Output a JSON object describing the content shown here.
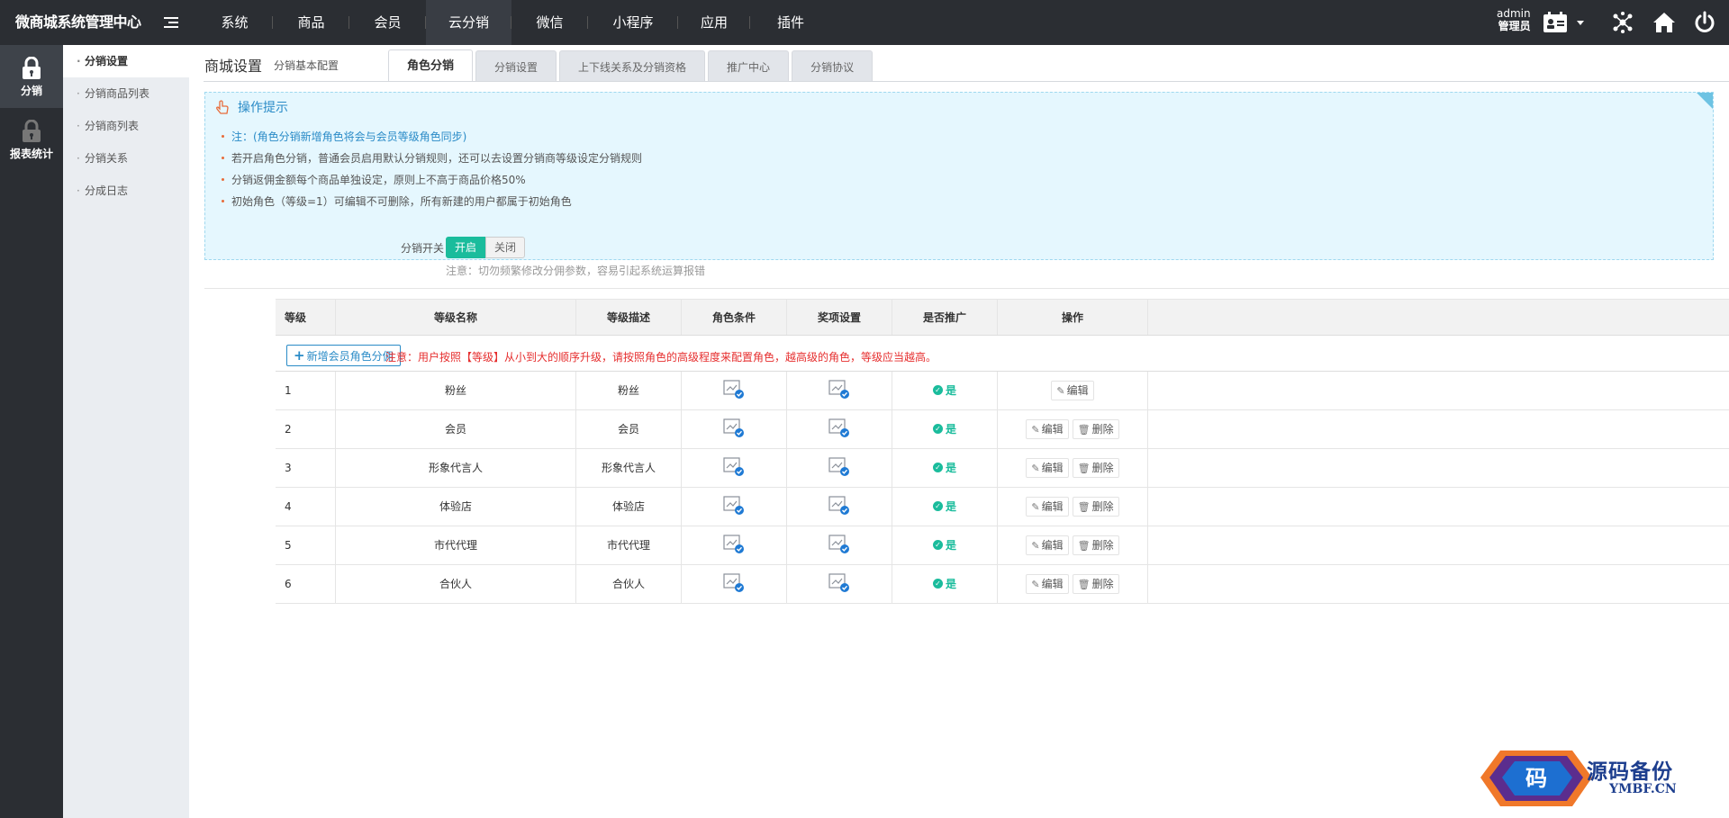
{
  "brand": "微商城系统管理中心",
  "top_nav": [
    {
      "label": "系统",
      "active": false
    },
    {
      "label": "商品",
      "active": false
    },
    {
      "label": "会员",
      "active": false
    },
    {
      "label": "云分销",
      "active": true
    },
    {
      "label": "微信",
      "active": false
    },
    {
      "label": "小程序",
      "active": false
    },
    {
      "label": "应用",
      "active": false
    },
    {
      "label": "插件",
      "active": false
    }
  ],
  "user": {
    "name": "admin",
    "role": "管理员"
  },
  "top_icons": [
    "id-card-icon",
    "caret-down-icon",
    "network-icon",
    "home-icon",
    "power-icon"
  ],
  "left_nav": [
    {
      "label": "分销",
      "icon": "lock-icon",
      "active": true
    },
    {
      "label": "报表统计",
      "icon": "lock-icon",
      "active": false
    }
  ],
  "submenu": [
    {
      "label": "分销设置",
      "active": true
    },
    {
      "label": "分销商品列表",
      "active": false
    },
    {
      "label": "分销商列表",
      "active": false
    },
    {
      "label": "分销关系",
      "active": false
    },
    {
      "label": "分成日志",
      "active": false
    }
  ],
  "page": {
    "title": "商城设置",
    "subtitle": "分销基本配置"
  },
  "tabs": [
    {
      "label": "角色分销",
      "active": true
    },
    {
      "label": "分销设置",
      "active": false
    },
    {
      "label": "上下线关系及分销资格",
      "active": false
    },
    {
      "label": "推广中心",
      "active": false
    },
    {
      "label": "分销协议",
      "active": false
    }
  ],
  "tips": {
    "title": "操作提示",
    "items": [
      {
        "text": "注：(角色分销新增角色将会与会员等级角色同步)",
        "highlight": true
      },
      {
        "text": "若开启角色分销，普通会员启用默认分销规则，还可以去设置分销商等级设定分销规则",
        "highlight": false
      },
      {
        "text": "分销返佣金额每个商品单独设定，原则上不高于商品价格50%",
        "highlight": false
      },
      {
        "text": "初始角色（等级=1）可编辑不可删除，所有新建的用户都属于初始角色",
        "highlight": false
      }
    ]
  },
  "switch": {
    "label": "分销开关",
    "on_label": "开启",
    "off_label": "关闭",
    "value": "开启",
    "note": "注意：切勿频繁修改分佣参数，容易引起系统运算报错"
  },
  "table": {
    "columns": [
      "等级",
      "等级名称",
      "等级描述",
      "角色条件",
      "奖项设置",
      "是否推广",
      "操作"
    ],
    "add_button": "新增会员角色分佣",
    "add_note": "注意：用户按照【等级】从小到大的顺序升级，请按照角色的高级程度来配置角色，越高级的角色，等级应当越高。",
    "yes_label": "是",
    "edit_label": "编辑",
    "delete_label": "删除",
    "rows": [
      {
        "level": "1",
        "name": "粉丝",
        "desc": "粉丝",
        "promote": "是",
        "deletable": false
      },
      {
        "level": "2",
        "name": "会员",
        "desc": "会员",
        "promote": "是",
        "deletable": true
      },
      {
        "level": "3",
        "name": "形象代言人",
        "desc": "形象代言人",
        "promote": "是",
        "deletable": true
      },
      {
        "level": "4",
        "name": "体验店",
        "desc": "体验店",
        "promote": "是",
        "deletable": true
      },
      {
        "level": "5",
        "name": "市代代理",
        "desc": "市代代理",
        "promote": "是",
        "deletable": true
      },
      {
        "level": "6",
        "name": "合伙人",
        "desc": "合伙人",
        "promote": "是",
        "deletable": true
      }
    ]
  },
  "watermark": {
    "text": "源码备份",
    "url": "YMBF.CN",
    "logo_char": "码"
  },
  "colors": {
    "topbar": "#2b2e33",
    "accent": "#1abc9c",
    "link": "#2a8bc7",
    "warning": "#e62e2e"
  }
}
